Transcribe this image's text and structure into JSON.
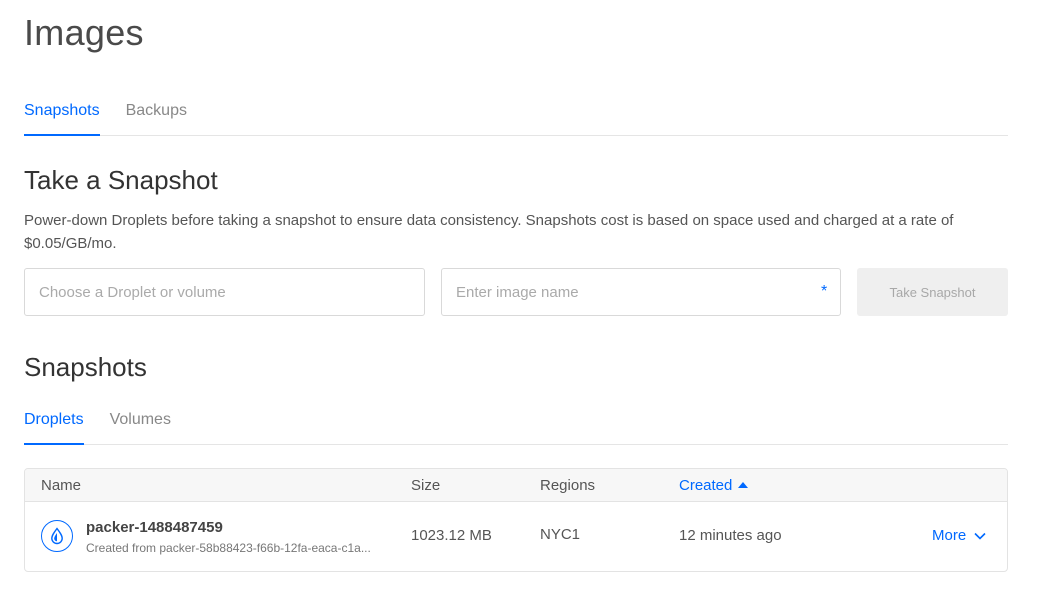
{
  "page": {
    "title": "Images"
  },
  "top_tabs": [
    {
      "label": "Snapshots",
      "active": true
    },
    {
      "label": "Backups",
      "active": false
    }
  ],
  "take_snapshot": {
    "title": "Take a Snapshot",
    "description": "Power-down Droplets before taking a snapshot to ensure data consistency. Snapshots cost is based on space used and charged at a rate of $0.05/GB/mo.",
    "droplet_placeholder": "Choose a Droplet or volume",
    "droplet_value": "",
    "image_placeholder": "Enter image name",
    "image_value": "",
    "required_mark": "*",
    "button_label": "Take Snapshot"
  },
  "snapshots": {
    "title": "Snapshots",
    "tabs": [
      {
        "label": "Droplets",
        "active": true
      },
      {
        "label": "Volumes",
        "active": false
      }
    ],
    "columns": {
      "name": "Name",
      "size": "Size",
      "regions": "Regions",
      "created": "Created"
    },
    "rows": [
      {
        "name": "packer-1488487459",
        "subtitle": "Created from packer-58b88423-f66b-12fa-eaca-c1a...",
        "size": "1023.12 MB",
        "region": "NYC1",
        "created": "12 minutes ago",
        "more_label": "More",
        "icon": "droplet-icon"
      }
    ]
  },
  "colors": {
    "accent": "#0069ff",
    "border": "#e3e3e3",
    "header_bg": "#f7f7f7",
    "disabled_button_bg": "#efefef"
  }
}
